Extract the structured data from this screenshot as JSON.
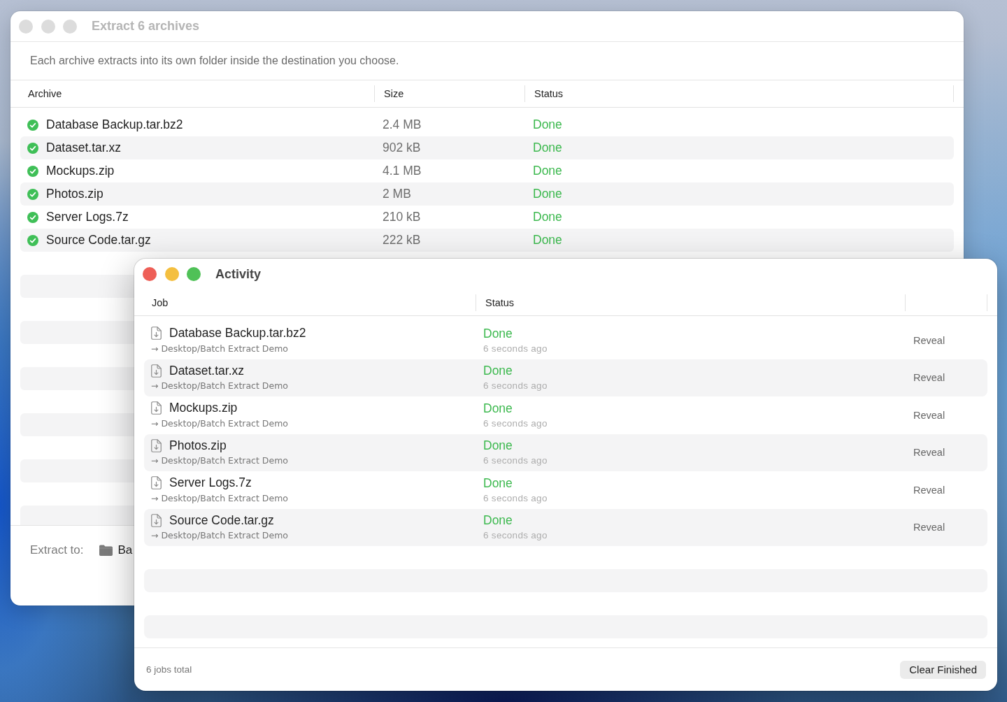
{
  "extract_window": {
    "title": "Extract 6 archives",
    "focused": false,
    "description": "Each archive extracts into its own folder inside the destination you choose.",
    "columns": [
      "Archive",
      "Size",
      "Status"
    ],
    "rows": [
      {
        "name": "Database Backup.tar.bz2",
        "size": "2.4 MB",
        "status": "Done",
        "done": true
      },
      {
        "name": "Dataset.tar.xz",
        "size": "902 kB",
        "status": "Done",
        "done": true
      },
      {
        "name": "Mockups.zip",
        "size": "4.1 MB",
        "status": "Done",
        "done": true
      },
      {
        "name": "Photos.zip",
        "size": "2 MB",
        "status": "Done",
        "done": true
      },
      {
        "name": "Server Logs.7z",
        "size": "210 kB",
        "status": "Done",
        "done": true
      },
      {
        "name": "Source Code.tar.gz",
        "size": "222 kB",
        "status": "Done",
        "done": true
      }
    ],
    "footer": {
      "label": "Extract to:",
      "destination": "Ba"
    }
  },
  "activity_window": {
    "title": "Activity",
    "focused": true,
    "columns": [
      "Job",
      "Status"
    ],
    "jobs": [
      {
        "name": "Database Backup.tar.bz2",
        "destination": "→ Desktop/Batch Extract Demo",
        "status": "Done",
        "time": "6 seconds ago",
        "done": true,
        "action": "Reveal"
      },
      {
        "name": "Dataset.tar.xz",
        "destination": "→ Desktop/Batch Extract Demo",
        "status": "Done",
        "time": "6 seconds ago",
        "done": true,
        "action": "Reveal"
      },
      {
        "name": "Mockups.zip",
        "destination": "→ Desktop/Batch Extract Demo",
        "status": "Done",
        "time": "6 seconds ago",
        "done": true,
        "action": "Reveal"
      },
      {
        "name": "Photos.zip",
        "destination": "→ Desktop/Batch Extract Demo",
        "status": "Done",
        "time": "6 seconds ago",
        "done": true,
        "action": "Reveal"
      },
      {
        "name": "Server Logs.7z",
        "destination": "→ Desktop/Batch Extract Demo",
        "status": "Done",
        "time": "6 seconds ago",
        "done": true,
        "action": "Reveal"
      },
      {
        "name": "Source Code.tar.gz",
        "destination": "→ Desktop/Batch Extract Demo",
        "status": "Done",
        "time": "6 seconds ago",
        "done": true,
        "action": "Reveal"
      }
    ],
    "total": "6 jobs total",
    "clear_button": "Clear Finished"
  }
}
